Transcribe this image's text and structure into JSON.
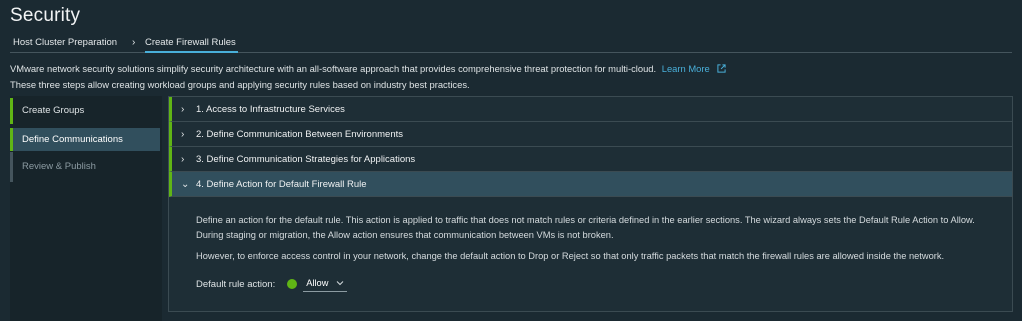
{
  "page": {
    "title": "Security"
  },
  "tabs": [
    {
      "label": "Host Cluster Preparation"
    },
    {
      "label": "Create Firewall Rules"
    }
  ],
  "description": {
    "line1": "VMware network security solutions simplify security architecture with an all-software approach that provides comprehensive threat protection for multi-cloud.",
    "learn_more": "Learn More",
    "line2": "These three steps allow creating workload groups and applying security rules based on industry best practices."
  },
  "steps": [
    {
      "label": "Create Groups"
    },
    {
      "label": "Define Communications"
    },
    {
      "label": "Review & Publish"
    }
  ],
  "sections": [
    {
      "label": "1. Access to Infrastructure Services"
    },
    {
      "label": "2. Define Communication Between Environments"
    },
    {
      "label": "3. Define Communication Strategies for Applications"
    },
    {
      "label": "4. Define Action for Default Firewall Rule"
    }
  ],
  "section4": {
    "para1": "Define an action for the default rule. This action is applied to traffic that does not match rules or criteria defined in the earlier sections. The wizard always sets the Default Rule Action to Allow. During staging or migration, the Allow action ensures that communication between VMs is not broken.",
    "para2": "However, to enforce access control in your network, change the default action to Drop or Reject so that only traffic packets that match the firewall rules are allowed inside the network.",
    "rule_label": "Default rule action:",
    "rule_value": "Allow"
  },
  "colors": {
    "background": "#1b2a32",
    "accent": "#49afd9",
    "success": "#60b515",
    "selected": "#314f5d"
  }
}
